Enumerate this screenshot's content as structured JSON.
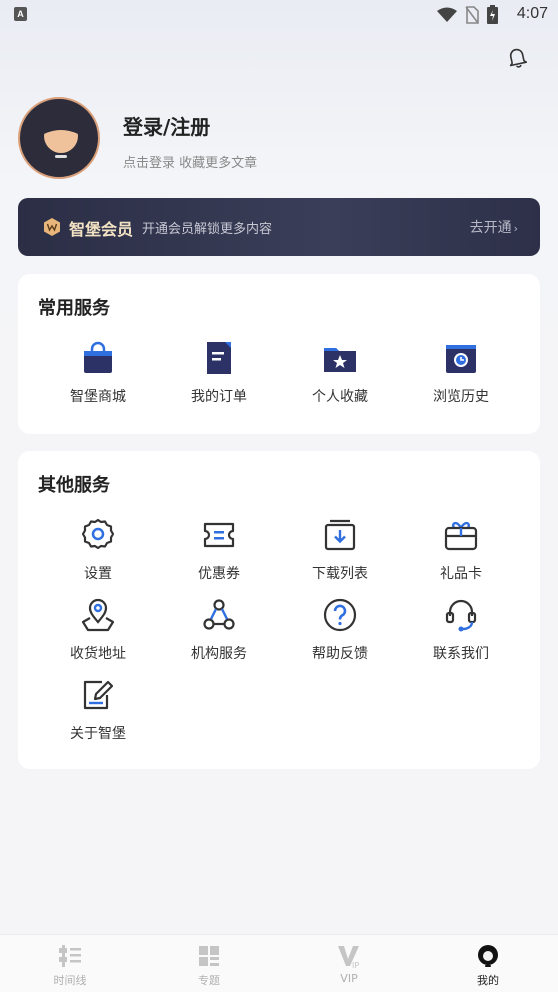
{
  "status_bar": {
    "time": "4:07"
  },
  "profile": {
    "title": "登录/注册",
    "subtitle": "点击登录 收藏更多文章"
  },
  "vip_banner": {
    "title": "智堡会员",
    "description": "开通会员解锁更多内容",
    "action": "去开通"
  },
  "common_services": {
    "title": "常用服务",
    "items": [
      {
        "label": "智堡商城",
        "icon": "shopping-bag-icon"
      },
      {
        "label": "我的订单",
        "icon": "order-document-icon"
      },
      {
        "label": "个人收藏",
        "icon": "star-folder-icon"
      },
      {
        "label": "浏览历史",
        "icon": "history-clock-icon"
      }
    ]
  },
  "other_services": {
    "title": "其他服务",
    "items": [
      {
        "label": "设置",
        "icon": "gear-icon"
      },
      {
        "label": "优惠券",
        "icon": "coupon-icon"
      },
      {
        "label": "下载列表",
        "icon": "download-box-icon"
      },
      {
        "label": "礼品卡",
        "icon": "gift-card-icon"
      },
      {
        "label": "收货地址",
        "icon": "location-map-icon"
      },
      {
        "label": "机构服务",
        "icon": "organization-nodes-icon"
      },
      {
        "label": "帮助反馈",
        "icon": "help-question-icon"
      },
      {
        "label": "联系我们",
        "icon": "headset-icon"
      },
      {
        "label": "关于智堡",
        "icon": "edit-note-icon"
      }
    ]
  },
  "tabbar": {
    "items": [
      {
        "label": "时间线",
        "icon": "timeline-icon"
      },
      {
        "label": "专题",
        "icon": "topics-grid-icon"
      },
      {
        "label": "VIP",
        "icon": "vip-icon"
      },
      {
        "label": "我的",
        "icon": "profile-face-icon",
        "active": true
      }
    ]
  },
  "colors": {
    "accent_blue": "#2f6fe0",
    "navy": "#2c3266",
    "vip_gold": "#f3e3c4"
  }
}
